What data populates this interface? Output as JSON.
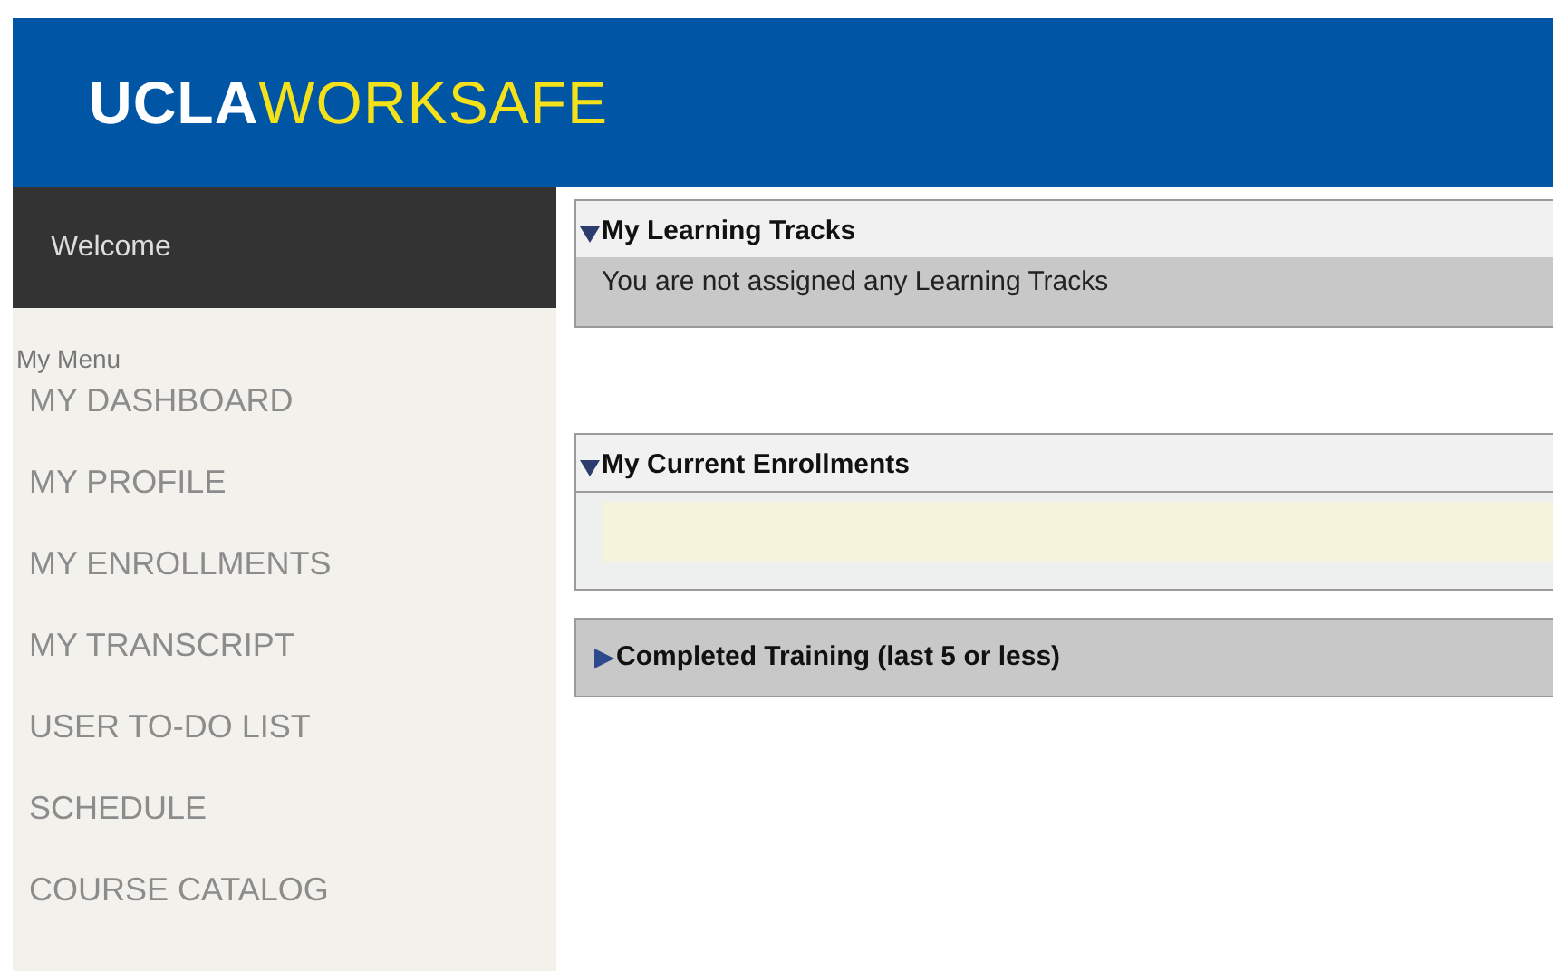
{
  "header": {
    "logo_primary": "UCLA",
    "logo_secondary": "WORKSAFE"
  },
  "sidebar": {
    "welcome": "Welcome",
    "menu_title": "My Menu",
    "items": [
      {
        "label": "MY DASHBOARD"
      },
      {
        "label": "MY PROFILE"
      },
      {
        "label": "MY ENROLLMENTS"
      },
      {
        "label": "MY TRANSCRIPT"
      },
      {
        "label": "USER TO-DO LIST"
      },
      {
        "label": "SCHEDULE"
      },
      {
        "label": "COURSE CATALOG"
      }
    ]
  },
  "panels": [
    {
      "title": "My Learning Tracks",
      "expanded": true,
      "kind": "message",
      "body": "You are not assigned any Learning Tracks"
    },
    {
      "title": "My Current Enrollments",
      "expanded": true,
      "kind": "empty-list"
    },
    {
      "title": "Completed Training (last 5 or less)",
      "expanded": false,
      "kind": "collapsed"
    }
  ]
}
